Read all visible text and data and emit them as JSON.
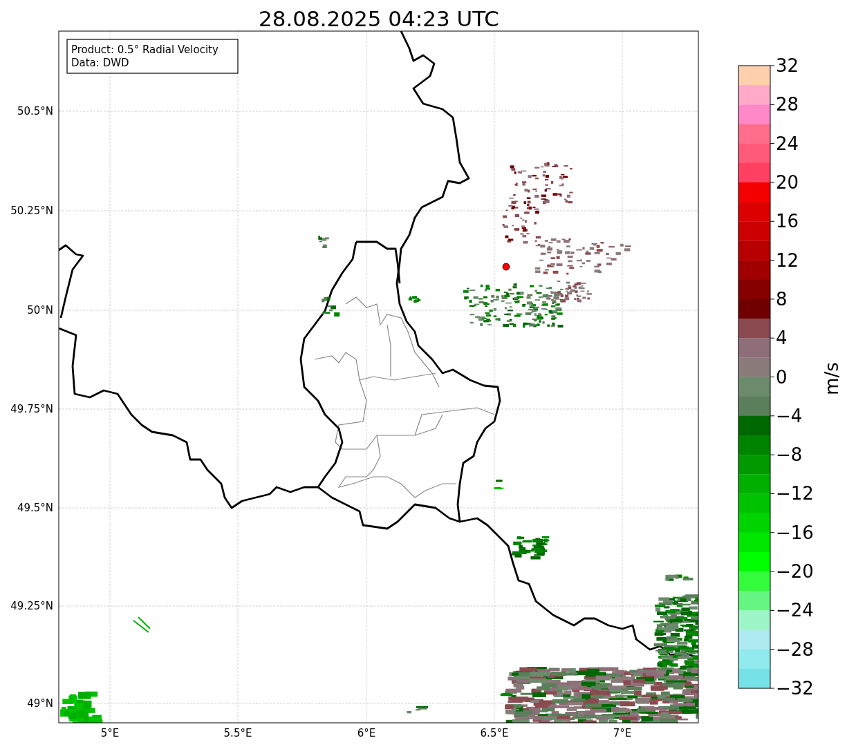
{
  "title": "28.08.2025 04:23 UTC",
  "info_box": [
    "Product: 0.5° Radial Velocity",
    "Data: DWD"
  ],
  "map": {
    "lat_ticks": [
      "50.5°N",
      "50.25°N",
      "50°N",
      "49.75°N",
      "49.5°N",
      "49.25°N",
      "49°N"
    ],
    "lon_ticks": [
      "5°E",
      "5.5°E",
      "6°E",
      "6.5°E",
      "7°E"
    ]
  },
  "colorbar": {
    "label": "m/s",
    "ticks": [
      "32",
      "28",
      "24",
      "20",
      "16",
      "12",
      "8",
      "4",
      "0",
      "−4",
      "−8",
      "−12",
      "−16",
      "−20",
      "−24",
      "−28",
      "−32"
    ],
    "bands": [
      {
        "color": "#ffd0b0"
      },
      {
        "color": "#ffaac8"
      },
      {
        "color": "#ff88c8"
      },
      {
        "color": "#ff6e8c"
      },
      {
        "color": "#ff5a78"
      },
      {
        "color": "#ff4060"
      },
      {
        "color": "#f50000"
      },
      {
        "color": "#dd0000"
      },
      {
        "color": "#cc0000"
      },
      {
        "color": "#b80000"
      },
      {
        "color": "#a00000"
      },
      {
        "color": "#860000"
      },
      {
        "color": "#700000"
      },
      {
        "color": "#8a4a50"
      },
      {
        "color": "#8e6e78"
      },
      {
        "color": "#8a7a7a"
      },
      {
        "color": "#6c8a6c"
      },
      {
        "color": "#5a7f5a"
      },
      {
        "color": "#006800"
      },
      {
        "color": "#008400"
      },
      {
        "color": "#009a00"
      },
      {
        "color": "#00b000"
      },
      {
        "color": "#00c200"
      },
      {
        "color": "#00d400"
      },
      {
        "color": "#00e800"
      },
      {
        "color": "#00ff00"
      },
      {
        "color": "#33fc3c"
      },
      {
        "color": "#66f582"
      },
      {
        "color": "#9ef5c8"
      },
      {
        "color": "#aeeaf0"
      },
      {
        "color": "#90eaee"
      },
      {
        "color": "#76e2e8"
      }
    ]
  }
}
